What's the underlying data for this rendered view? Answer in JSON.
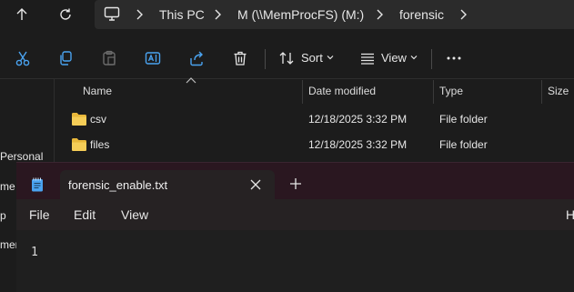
{
  "explorer": {
    "breadcrumb": [
      "This PC",
      "M (\\\\MemProcFS) (M:)",
      "forensic"
    ],
    "toolbar": {
      "sort_label": "Sort",
      "view_label": "View"
    },
    "columns": [
      "Name",
      "Date modified",
      "Type",
      "Size"
    ],
    "files": [
      {
        "name": "csv",
        "date_modified": "12/18/2025 3:32 PM",
        "type": "File folder",
        "size": ""
      },
      {
        "name": "files",
        "date_modified": "12/18/2025 3:32 PM",
        "type": "File folder",
        "size": ""
      }
    ],
    "nav_pane_fragments": [
      "Personal",
      "me",
      "p",
      "ment"
    ],
    "colors": {
      "folder": "#e8b73a",
      "accent": "#4aa3f0"
    }
  },
  "notepad": {
    "tab_title": "forensic_enable.txt",
    "menu": [
      "File",
      "Edit",
      "View"
    ],
    "menu_right_fragment": "H",
    "line_number": "1",
    "colors": {
      "titlebar": "#2a1720",
      "tab": "#262223"
    }
  }
}
